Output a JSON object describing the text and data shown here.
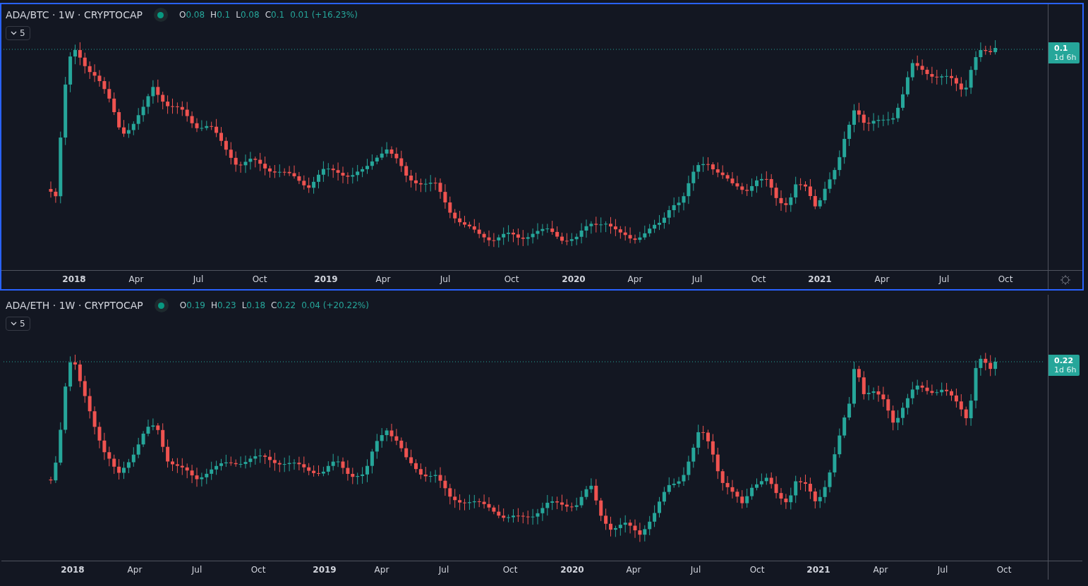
{
  "panes": [
    {
      "title": "ADA/BTC · 1W · CRYPTOCAP",
      "selected": true,
      "show_settings": true,
      "ohlc": [
        {
          "label": "O",
          "value": "0.08"
        },
        {
          "label": "H",
          "value": "0.1"
        },
        {
          "label": "L",
          "value": "0.08"
        },
        {
          "label": "C",
          "value": "0.1"
        }
      ],
      "change": "0.01 (+16.23%)",
      "indicator_count": "5",
      "price_label": {
        "price": "0.1",
        "countdown": "1d 6h"
      },
      "time_axis": [
        {
          "label": "2018",
          "kind": "year"
        },
        {
          "label": "Apr",
          "kind": "month"
        },
        {
          "label": "Jul",
          "kind": "month"
        },
        {
          "label": "Oct",
          "kind": "month"
        },
        {
          "label": "2019",
          "kind": "year"
        },
        {
          "label": "Apr",
          "kind": "month"
        },
        {
          "label": "Jul",
          "kind": "month"
        },
        {
          "label": "Oct",
          "kind": "month"
        },
        {
          "label": "2020",
          "kind": "year"
        },
        {
          "label": "Apr",
          "kind": "month"
        },
        {
          "label": "Jul",
          "kind": "month"
        },
        {
          "label": "Oct",
          "kind": "month"
        },
        {
          "label": "2021",
          "kind": "year"
        },
        {
          "label": "Apr",
          "kind": "month"
        },
        {
          "label": "Jul",
          "kind": "month"
        },
        {
          "label": "Oct",
          "kind": "month"
        }
      ]
    },
    {
      "title": "ADA/ETH · 1W · CRYPTOCAP",
      "selected": false,
      "show_settings": false,
      "ohlc": [
        {
          "label": "O",
          "value": "0.19"
        },
        {
          "label": "H",
          "value": "0.23"
        },
        {
          "label": "L",
          "value": "0.18"
        },
        {
          "label": "C",
          "value": "0.22"
        }
      ],
      "change": "0.04 (+20.22%)",
      "indicator_count": "5",
      "price_label": {
        "price": "0.22",
        "countdown": "1d 6h"
      },
      "time_axis": [
        {
          "label": "2018",
          "kind": "year"
        },
        {
          "label": "Apr",
          "kind": "month"
        },
        {
          "label": "Jul",
          "kind": "month"
        },
        {
          "label": "Oct",
          "kind": "month"
        },
        {
          "label": "2019",
          "kind": "year"
        },
        {
          "label": "Apr",
          "kind": "month"
        },
        {
          "label": "Jul",
          "kind": "month"
        },
        {
          "label": "Oct",
          "kind": "month"
        },
        {
          "label": "2020",
          "kind": "year"
        },
        {
          "label": "Apr",
          "kind": "month"
        },
        {
          "label": "Jul",
          "kind": "month"
        },
        {
          "label": "Oct",
          "kind": "month"
        },
        {
          "label": "2021",
          "kind": "year"
        },
        {
          "label": "Apr",
          "kind": "month"
        },
        {
          "label": "Jul",
          "kind": "month"
        },
        {
          "label": "Oct",
          "kind": "month"
        }
      ]
    }
  ]
}
